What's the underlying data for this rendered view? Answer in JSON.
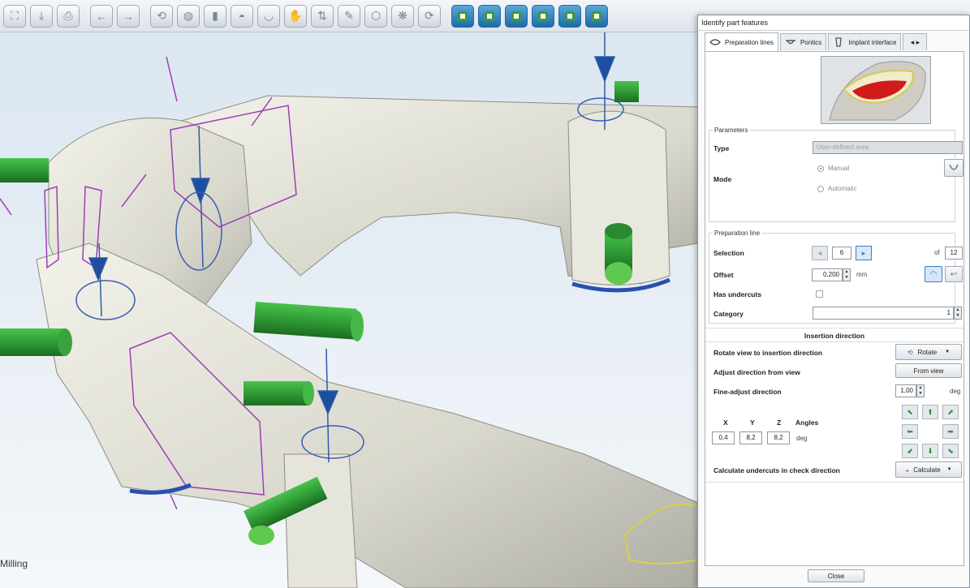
{
  "toolbar": {
    "buttons": [
      "fullscreen-icon",
      "save-icon",
      "print-icon",
      "undo-icon",
      "redo-icon",
      "rotate-view-icon",
      "cylinder-icon",
      "part-icon",
      "tooth-icon",
      "bridge-icon",
      "hand-icon",
      "tools-icon",
      "brush-icon",
      "sculpt-icon",
      "morph-icon",
      "rotate-icon"
    ],
    "view_buttons": [
      "view-front-icon",
      "view-back-icon",
      "view-left-icon",
      "view-right-icon",
      "view-top-icon",
      "view-bottom-icon",
      "view-iso-icon"
    ]
  },
  "viewport": {
    "mode_label": "Milling"
  },
  "dialog": {
    "title": "Identify part features",
    "tabs": [
      "Preparation lines",
      "Pontics",
      "Implant interface"
    ],
    "tab_scroll": "◂ ▸",
    "parameters": {
      "legend": "Parameters",
      "type_label": "Type",
      "type_value": "User-defined area",
      "mode_label": "Mode",
      "mode_options": [
        "Manual",
        "Automatic"
      ],
      "mode_selected": "Manual"
    },
    "prep_line": {
      "legend": "Preparation line",
      "selection_label": "Selection",
      "selection_value": "6",
      "of_label": "of",
      "of_value": "12",
      "offset_label": "Offset",
      "offset_value": "0,200",
      "offset_unit": "mm",
      "undercuts_label": "Has undercuts",
      "undercuts_checked": false,
      "category_label": "Category",
      "category_value": "1"
    },
    "insertion": {
      "header": "Insertion direction",
      "rotate_label": "Rotate view to insertion direction",
      "rotate_button": "Rotate",
      "adjust_label": "Adjust direction from view",
      "adjust_button": "From view",
      "fine_label": "Fine-adjust direction",
      "fine_value": "1,00",
      "fine_unit": "deg",
      "x_label": "X",
      "y_label": "Y",
      "z_label": "Z",
      "angles_label": "Angles",
      "x_value": "0,4",
      "y_value": "8,2",
      "z_value": "8,2",
      "angles_unit": "deg",
      "calc_label": "Calculate undercuts in check direction",
      "calc_button": "Calculate"
    },
    "close_button": "Close"
  }
}
